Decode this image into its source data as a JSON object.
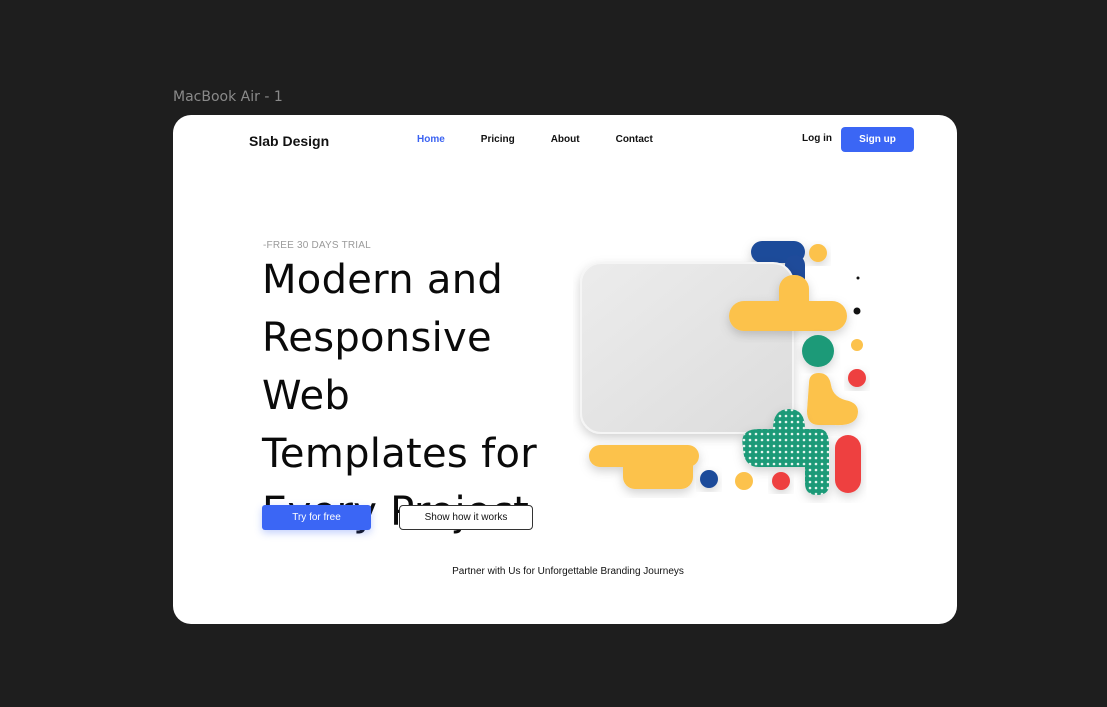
{
  "frame": {
    "label": "MacBook Air - 1"
  },
  "header": {
    "brand": "Slab Design",
    "nav": [
      {
        "label": "Home",
        "active": true
      },
      {
        "label": "Pricing",
        "active": false
      },
      {
        "label": "About",
        "active": false
      },
      {
        "label": "Contact",
        "active": false
      }
    ],
    "login_label": "Log in",
    "signup_label": "Sign up"
  },
  "hero": {
    "eyebrow": "-FREE 30 DAYS TRIAL",
    "headline_lines": [
      "Modern and",
      "Responsive Web",
      "Templates for",
      "Every Project"
    ],
    "primary_cta": "Try for free",
    "secondary_cta": "Show how it works"
  },
  "footer": {
    "tagline": "Partner with Us for Unforgettable Branding Journeys"
  },
  "colors": {
    "accent": "#3b66f5",
    "yellow": "#fcc24c",
    "green": "#1f9a78",
    "navy": "#1f4b9a",
    "red": "#ee4040"
  }
}
